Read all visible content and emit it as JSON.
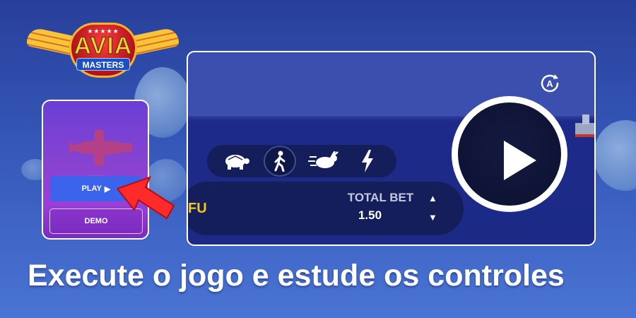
{
  "logo": {
    "line1": "AVIA",
    "line2": "MASTERS",
    "stars": "★★★★★"
  },
  "phone": {
    "play_label": "PLAY",
    "play_icon": "play-triangle-icon",
    "demo_label": "DEMO"
  },
  "screen": {
    "partial_text": "FU",
    "speed_options": [
      "turtle-icon",
      "walking-person-icon",
      "running-rabbit-icon",
      "lightning-icon"
    ],
    "total_bet_label": "TOTAL BET",
    "total_bet_value": "1.50",
    "bet_up": "▲",
    "bet_down": "▼",
    "auto_icon": "auto-play-icon"
  },
  "caption": "Execute o jogo e estude os controles",
  "colors": {
    "accent_blue": "#3b63ec",
    "gold": "#f6c61a",
    "background": "#3557b8"
  }
}
